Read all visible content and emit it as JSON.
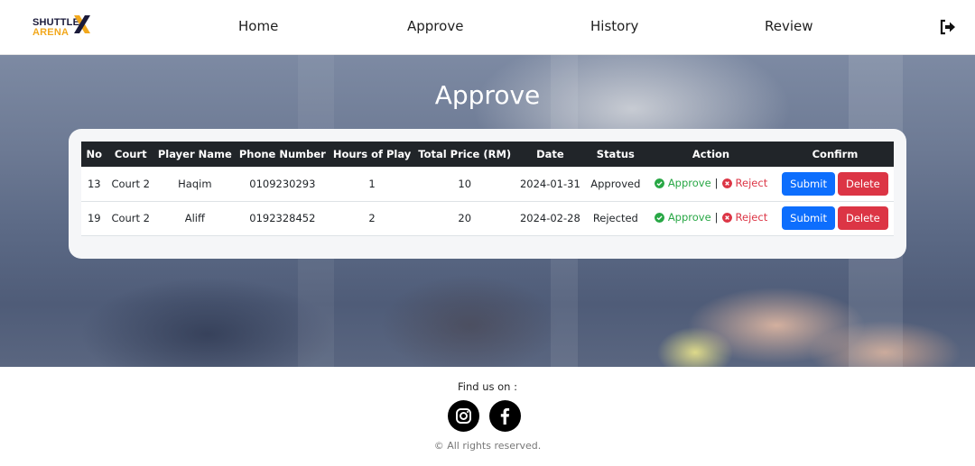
{
  "brand": {
    "line1": "SHUTTLE",
    "line2": "ARENA",
    "line1_color": "#1a1a3a",
    "line2_color": "#f2a81d"
  },
  "nav": [
    {
      "label": "Home"
    },
    {
      "label": "Approve"
    },
    {
      "label": "History"
    },
    {
      "label": "Review"
    }
  ],
  "header": {
    "logout_icon": "logout-icon"
  },
  "page": {
    "title": "Approve"
  },
  "table": {
    "columns": [
      "No",
      "Court",
      "Player Name",
      "Phone Number",
      "Hours of Play",
      "Total Price (RM)",
      "Date",
      "Status",
      "Action",
      "Confirm"
    ],
    "rows": [
      {
        "no": "13",
        "court": "Court 2",
        "player": "Haqim",
        "phone": "0109230293",
        "hours": "1",
        "price": "10",
        "date": "2024-01-31",
        "status": "Approved"
      },
      {
        "no": "19",
        "court": "Court 2",
        "player": "Aliff",
        "phone": "0192328452",
        "hours": "2",
        "price": "20",
        "date": "2024-02-28",
        "status": "Rejected"
      }
    ],
    "action_approve": "Approve",
    "action_separator": "|",
    "action_reject": "Reject",
    "submit_label": "Submit",
    "delete_label": "Delete"
  },
  "colors": {
    "approve": "#28a745",
    "reject": "#dc3545",
    "submit": "#0d6efd",
    "delete": "#dc3545",
    "table_header": "#212529"
  },
  "footer": {
    "find_us": "Find us on :",
    "social": [
      {
        "icon": "instagram-icon"
      },
      {
        "icon": "facebook-icon"
      }
    ],
    "copyright": "© All rights reserved."
  }
}
